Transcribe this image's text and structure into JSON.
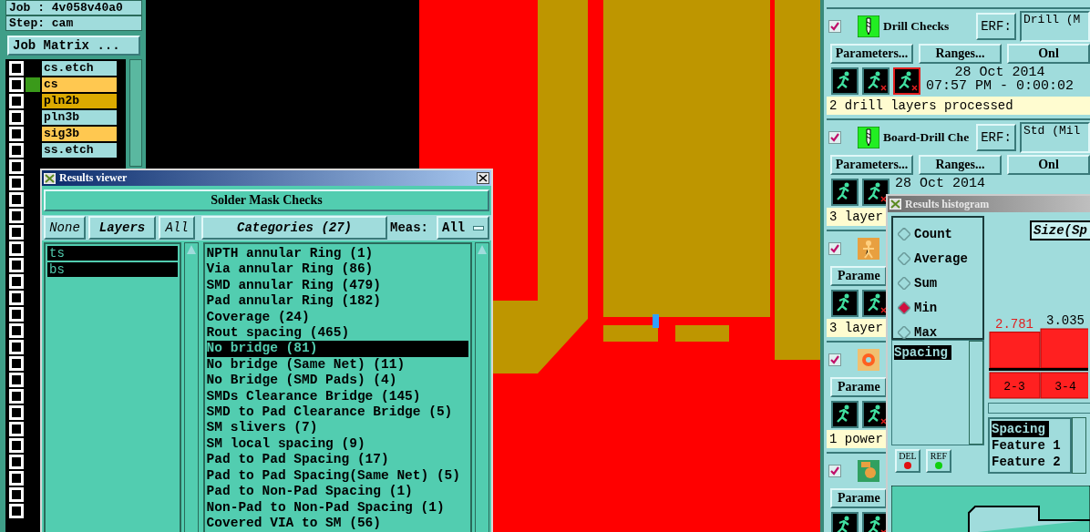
{
  "job_panel": {
    "job": "Job : 4v058v40a0",
    "step": "Step: cam",
    "matrix_button": "Job Matrix ...",
    "layers": [
      {
        "name": "cs.etch",
        "color": "#a0dcdc",
        "marked": false,
        "checked": false
      },
      {
        "name": "cs",
        "color": "#ffc850",
        "marked": true,
        "checked": false
      },
      {
        "name": "pln2b",
        "color": "#dcaa00",
        "marked": false,
        "checked": false
      },
      {
        "name": "pln3b",
        "color": "#a0dcdc",
        "marked": false,
        "checked": false
      },
      {
        "name": "sig3b",
        "color": "#ffc850",
        "marked": false,
        "checked": false
      },
      {
        "name": "ss.etch",
        "color": "#a0dcdc",
        "marked": false,
        "checked": false
      },
      {
        "checked": false
      },
      {
        "checked": false
      },
      {
        "checked": false
      },
      {
        "checked": false
      },
      {
        "checked": false
      },
      {
        "checked": false
      },
      {
        "checked": false
      },
      {
        "checked": false
      },
      {
        "checked": false
      },
      {
        "checked": false
      },
      {
        "checked": false
      },
      {
        "checked": false
      },
      {
        "checked": false
      },
      {
        "checked": false
      },
      {
        "checked": false
      },
      {
        "checked": false
      },
      {
        "checked": false
      },
      {
        "checked": false
      },
      {
        "checked": false
      },
      {
        "checked": false
      },
      {
        "checked": false
      },
      {
        "checked": false
      }
    ]
  },
  "results_viewer": {
    "title": "Results viewer",
    "header": "Solder Mask Checks",
    "none_button": "None",
    "layers_label": "Layers",
    "all_button": "All",
    "categories_button": "Categories (27)",
    "meas_label": "Meas:",
    "meas_value": "All",
    "layers": [
      {
        "name": "ts",
        "selected": true
      },
      {
        "name": "bs",
        "selected": true
      }
    ],
    "categories": [
      {
        "name": "NPTH annular Ring (1)",
        "selected": false
      },
      {
        "name": "Via annular Ring (86)",
        "selected": false
      },
      {
        "name": "SMD annular Ring (479)",
        "selected": false
      },
      {
        "name": "Pad annular Ring (182)",
        "selected": false
      },
      {
        "name": "Coverage (24)",
        "selected": false
      },
      {
        "name": "Rout spacing (465)",
        "selected": false
      },
      {
        "name": "No bridge (81)",
        "selected": true
      },
      {
        "name": "No bridge (Same Net) (11)",
        "selected": false
      },
      {
        "name": "No Bridge (SMD Pads) (4)",
        "selected": false
      },
      {
        "name": "SMDs Clearance Bridge (145)",
        "selected": false
      },
      {
        "name": "SMD to Pad Clearance Bridge (5)",
        "selected": false
      },
      {
        "name": "SM slivers (7)",
        "selected": false
      },
      {
        "name": "SM local spacing (9)",
        "selected": false
      },
      {
        "name": "Pad to Pad Spacing (17)",
        "selected": false
      },
      {
        "name": "Pad to Pad Spacing(Same Net) (5)",
        "selected": false
      },
      {
        "name": "Pad to Non-Pad Spacing (1)",
        "selected": false
      },
      {
        "name": "Non-Pad to Non-Pad Spacing (1)",
        "selected": false
      },
      {
        "name": "Covered VIA to SM (56)",
        "selected": false
      }
    ]
  },
  "checks": [
    {
      "name": "Drill Checks",
      "kind": "drill",
      "checked": true,
      "erf_button": "ERF:",
      "erf_value": "Drill (M",
      "buttons": [
        "Parameters...",
        "Ranges...",
        "Onl"
      ],
      "date": "28 Oct 2014",
      "time": "07:57 PM - 0:00:02",
      "status": "2 drill layers processed"
    },
    {
      "name": "Board-Drill Che",
      "kind": "drill",
      "checked": true,
      "erf_button": "ERF:",
      "erf_value": "Std (Mil",
      "buttons": [
        "Parameters...",
        "Ranges...",
        "Onl"
      ],
      "date": "28 Oct 2014",
      "status": "3 layer"
    },
    {
      "kind": "person",
      "checked": true,
      "buttons": [
        "Parame"
      ],
      "status": "3 layer"
    },
    {
      "kind": "gear",
      "checked": true,
      "buttons": [
        "Parame"
      ],
      "status": "1 power"
    },
    {
      "kind": "board",
      "checked": true,
      "buttons": [
        "Parame"
      ]
    }
  ],
  "histogram": {
    "title": "Results histogram",
    "modes": [
      {
        "label": "Count",
        "selected": false
      },
      {
        "label": "Average",
        "selected": false
      },
      {
        "label": "Sum",
        "selected": false
      },
      {
        "label": "Min",
        "selected": true
      },
      {
        "label": "Max",
        "selected": false
      }
    ],
    "list": [
      {
        "label": "Spacing",
        "selected": true
      }
    ],
    "del_button": "DEL",
    "ref_button": "REF",
    "axis_button": "Size(Sp",
    "chart_data": {
      "type": "bar",
      "categories": [
        "2-3",
        "3-4"
      ],
      "values": [
        2.781,
        3.035
      ],
      "data_labels": true
    },
    "fields": [
      {
        "label": "Spacing",
        "selected": true
      },
      {
        "label": "Feature 1",
        "selected": false
      },
      {
        "label": "Feature 2",
        "selected": false
      }
    ]
  }
}
